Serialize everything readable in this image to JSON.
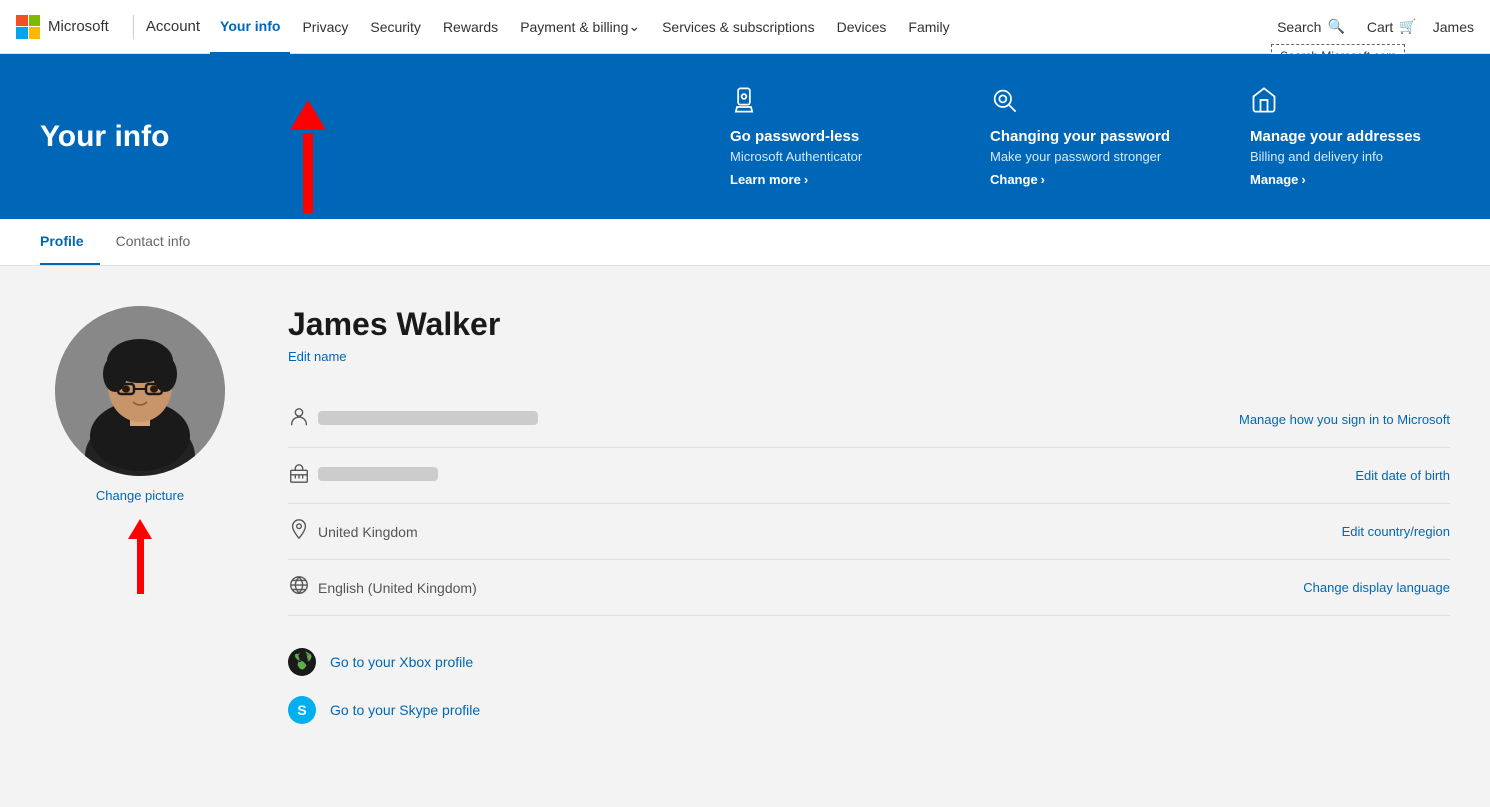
{
  "topnav": {
    "account_label": "Account",
    "your_info_label": "Your info",
    "links": [
      {
        "label": "Privacy",
        "active": false
      },
      {
        "label": "Security",
        "active": false
      },
      {
        "label": "Rewards",
        "active": false
      },
      {
        "label": "Payment & billing",
        "active": false,
        "dropdown": true
      },
      {
        "label": "Services & subscriptions",
        "active": false
      },
      {
        "label": "Devices",
        "active": false
      },
      {
        "label": "Family",
        "active": false
      }
    ],
    "search_label": "Search",
    "search_tooltip": "Search Microsoft.com",
    "cart_label": "Cart",
    "user_name": "James"
  },
  "banner": {
    "title": "Your info",
    "cards": [
      {
        "icon": "📱",
        "title": "Go password-less",
        "desc": "Microsoft Authenticator",
        "link_label": "Learn more",
        "link_arrow": "›"
      },
      {
        "icon": "🔍",
        "title": "Changing your password",
        "desc": "Make your password stronger",
        "link_label": "Change",
        "link_arrow": "›"
      },
      {
        "icon": "🏠",
        "title": "Manage your addresses",
        "desc": "Billing and delivery info",
        "link_label": "Manage",
        "link_arrow": "›"
      }
    ]
  },
  "tabs": [
    {
      "label": "Profile",
      "active": true
    },
    {
      "label": "Contact info",
      "active": false
    }
  ],
  "profile": {
    "name": "James Walker",
    "edit_name_label": "Edit name",
    "change_picture_label": "Change picture",
    "info_rows": [
      {
        "icon": "person",
        "value_type": "blurred",
        "action_label": "Manage how you sign in to Microsoft"
      },
      {
        "icon": "birthday",
        "value_type": "blurred_sm",
        "action_label": "Edit date of birth"
      },
      {
        "icon": "location",
        "value": "United Kingdom",
        "action_label": "Edit country/region"
      },
      {
        "icon": "language",
        "value": "English (United Kingdom)",
        "action_label": "Change display language"
      }
    ],
    "gaming_profiles": [
      {
        "type": "xbox",
        "link_label": "Go to your Xbox profile"
      },
      {
        "type": "skype",
        "link_label": "Go to your Skype profile"
      }
    ]
  }
}
